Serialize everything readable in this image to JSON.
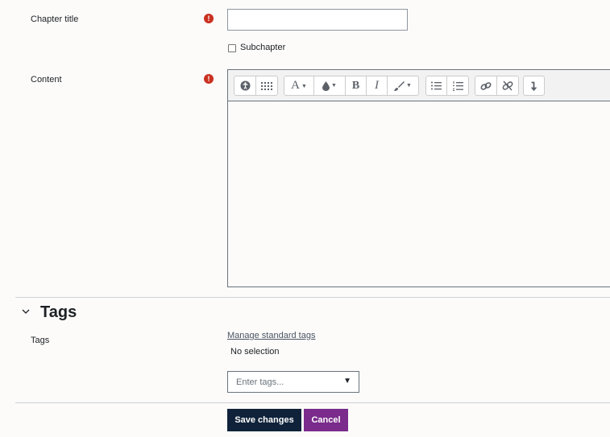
{
  "form": {
    "chapter_title": {
      "label": "Chapter title",
      "value": "",
      "required_icon": "!"
    },
    "subchapter": {
      "label": "Subchapter",
      "checked": false
    },
    "content": {
      "label": "Content",
      "required_icon": "!",
      "toolbar": [
        [
          "accessibility-checker-icon",
          "screenreader-helper-icon"
        ],
        [
          "font-style-icon",
          "font-color-icon",
          "bold-icon",
          "italic-icon",
          "paint-brush-icon"
        ],
        [
          "unordered-list-icon",
          "ordered-list-icon"
        ],
        [
          "link-icon",
          "unlink-icon"
        ],
        [
          "more-tools-icon"
        ]
      ],
      "toolbar_glyphs": {
        "bold": "B",
        "italic": "I",
        "font": "A"
      }
    }
  },
  "tags_section": {
    "heading": "Tags",
    "collapse_icon": "chevron-down-icon",
    "tags_label": "Tags",
    "manage_link": "Manage standard tags",
    "selection_text": "No selection",
    "input_placeholder": "Enter tags...",
    "dropdown_icon": "▼"
  },
  "actions": {
    "save_label": "Save changes",
    "cancel_label": "Cancel"
  },
  "colors": {
    "save_bg": "#0f223a",
    "cancel_bg": "#7a2b8b",
    "required": "#ca3120"
  }
}
